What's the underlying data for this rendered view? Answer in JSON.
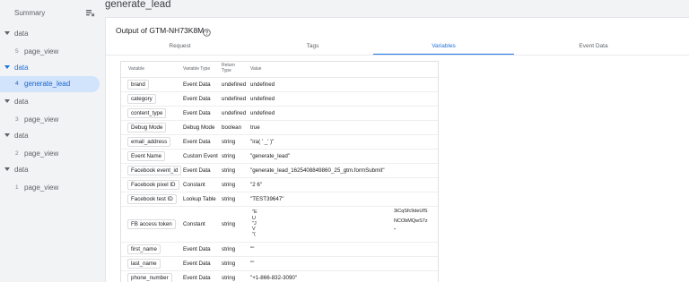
{
  "sidebar": {
    "summary_label": "Summary",
    "groups": [
      {
        "label": "data",
        "event_num": "5",
        "event_label": "page_view"
      },
      {
        "label": "data",
        "event_num": "4",
        "event_label": "generate_lead"
      },
      {
        "label": "data",
        "event_num": "3",
        "event_label": "page_view"
      },
      {
        "label": "data",
        "event_num": "2",
        "event_label": "page_view"
      },
      {
        "label": "data",
        "event_num": "1",
        "event_label": "page_view"
      }
    ],
    "active_index": 1
  },
  "page_title": "generate_lead",
  "output_title": "Output of GTM-NH73K8M",
  "tabs": [
    "Request",
    "Tags",
    "Variables",
    "Event Data"
  ],
  "active_tab": "Variables",
  "table": {
    "headers": {
      "variable": "Variable",
      "type": "Variable Type",
      "return_type_line1": "Return",
      "return_type_line2": "Type",
      "value": "Value"
    },
    "rows": [
      {
        "name": "brand",
        "type": "Event Data",
        "ret": "undefined",
        "value": "undefined"
      },
      {
        "name": "category",
        "type": "Event Data",
        "ret": "undefined",
        "value": "undefined"
      },
      {
        "name": "content_type",
        "type": "Event Data",
        "ret": "undefined",
        "value": "undefined"
      },
      {
        "name": "Debug Mode",
        "type": "Debug Mode",
        "ret": "boolean",
        "value": "true"
      },
      {
        "name": "email_address",
        "type": "Event Data",
        "ret": "string",
        "value": "\"ira(  ' _'           )\""
      },
      {
        "name": "Event Name",
        "type": "Custom Event",
        "ret": "string",
        "value": "\"generate_lead\""
      },
      {
        "name": "Facebook event_id",
        "type": "Event Data",
        "ret": "string",
        "value": "\"generate_lead_1625408849860_25_gtm.formSubmit\""
      },
      {
        "name": "Facebook pixel ID",
        "type": "Constant",
        "ret": "string",
        "value": "\"2                          6\""
      },
      {
        "name": "Facebook test ID",
        "type": "Lookup Table",
        "ret": "string",
        "value": "\"TEST39647\""
      },
      {
        "name": "FB access token",
        "type": "Constant",
        "ret": "string",
        "value_lines": [
          "\"E",
          "U",
          "\"J",
          "V",
          "\"("
        ],
        "value_right_lines": [
          "3iCqSfc9deUfS",
          "NCObMQwS7z",
          "\""
        ]
      },
      {
        "name": "first_name",
        "type": "Event Data",
        "ret": "string",
        "value": "\"\""
      },
      {
        "name": "last_name",
        "type": "Event Data",
        "ret": "string",
        "value": "\"\""
      },
      {
        "name": "phone_number",
        "type": "Event Data",
        "ret": "string",
        "value": "\"+1-866-832-3090\""
      }
    ]
  }
}
